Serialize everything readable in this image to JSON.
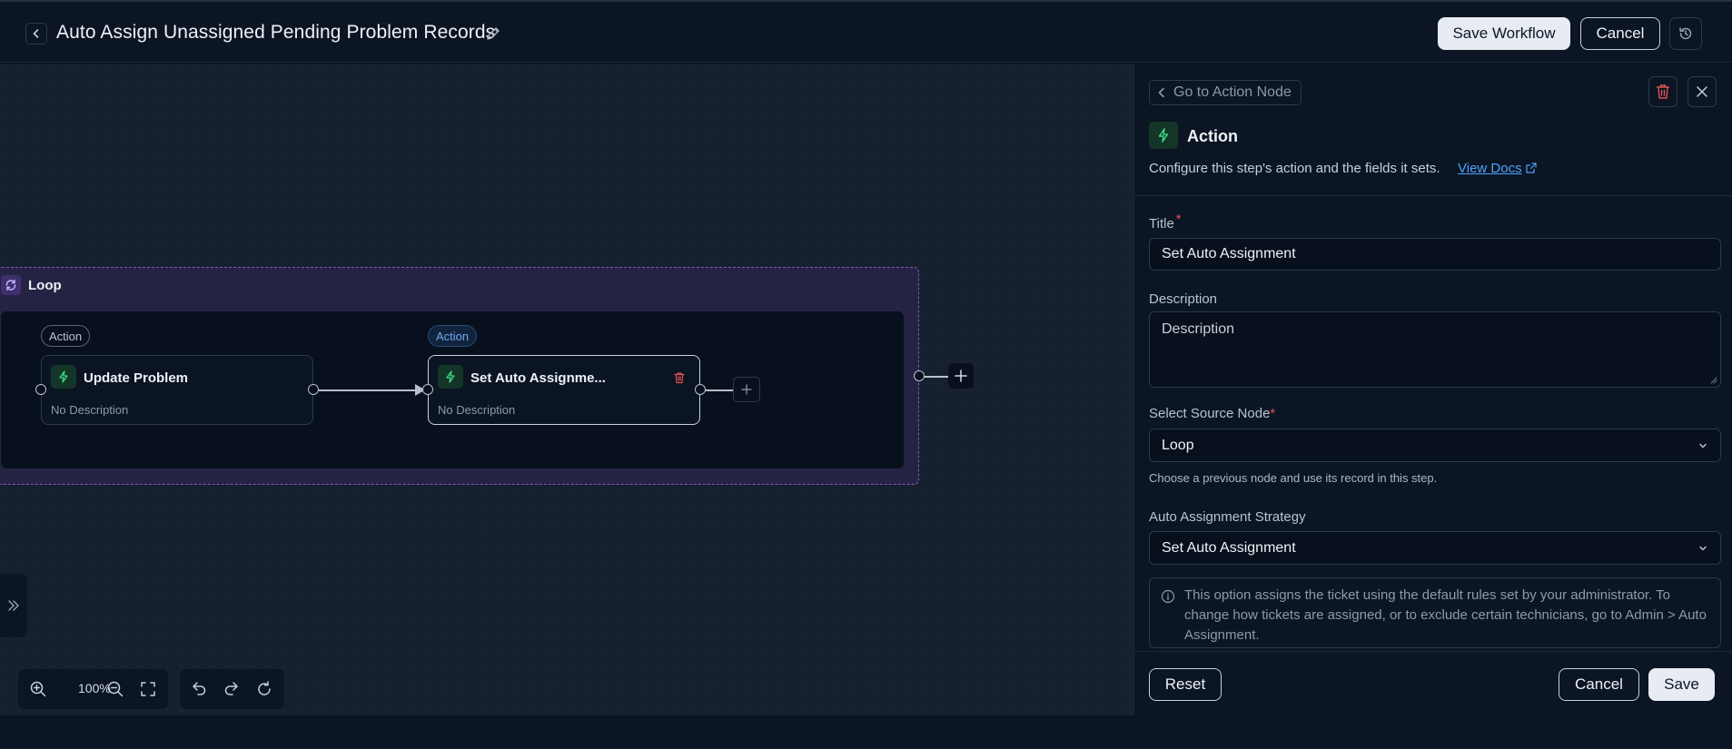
{
  "header": {
    "title": "Auto Assign Unassigned Pending Problem Records",
    "save_workflow_label": "Save Workflow",
    "cancel_label": "Cancel"
  },
  "canvas": {
    "loop": {
      "title": "Loop",
      "nodes": [
        {
          "tag": "Action",
          "title": "Update Problem",
          "description": "No Description"
        },
        {
          "tag": "Action",
          "title": "Set Auto Assignme...",
          "description": "No Description"
        }
      ]
    },
    "zoom_level": "100%"
  },
  "panel": {
    "goto_label": "Go to Action Node",
    "action_title": "Action",
    "config_text": "Configure this step's action and the fields it sets.",
    "docs_link": "View Docs",
    "title_field": {
      "label": "Title",
      "value": "Set Auto Assignment"
    },
    "description_field": {
      "label": "Description",
      "placeholder": "Description"
    },
    "source_node": {
      "label": "Select Source Node",
      "value": "Loop",
      "hint": "Choose a previous node and use its record in this step."
    },
    "strategy": {
      "label": "Auto Assignment Strategy",
      "value": "Set Auto Assignment"
    },
    "info_text": "This option assigns the ticket using the default rules set by your administrator. To change how tickets are assigned, or to exclude certain technicians, go to Admin > Auto Assignment.",
    "footer": {
      "reset_label": "Reset",
      "cancel_label": "Cancel",
      "save_label": "Save"
    }
  },
  "colors": {
    "accent_green": "#3ddc84",
    "danger_red": "#e05252",
    "link_blue": "#4ea3ff",
    "loop_purple": "#7b58c5"
  },
  "icons": [
    "back-icon",
    "pencil-icon",
    "history-icon",
    "loop-icon",
    "bolt-icon",
    "trash-icon",
    "plus-icon",
    "expand-sidebar-icon",
    "zoom-in-icon",
    "zoom-out-icon",
    "fit-view-icon",
    "undo-icon",
    "redo-icon",
    "refresh-icon",
    "chevron-left-icon",
    "close-icon",
    "external-link-icon",
    "chevron-down-icon",
    "info-icon"
  ]
}
